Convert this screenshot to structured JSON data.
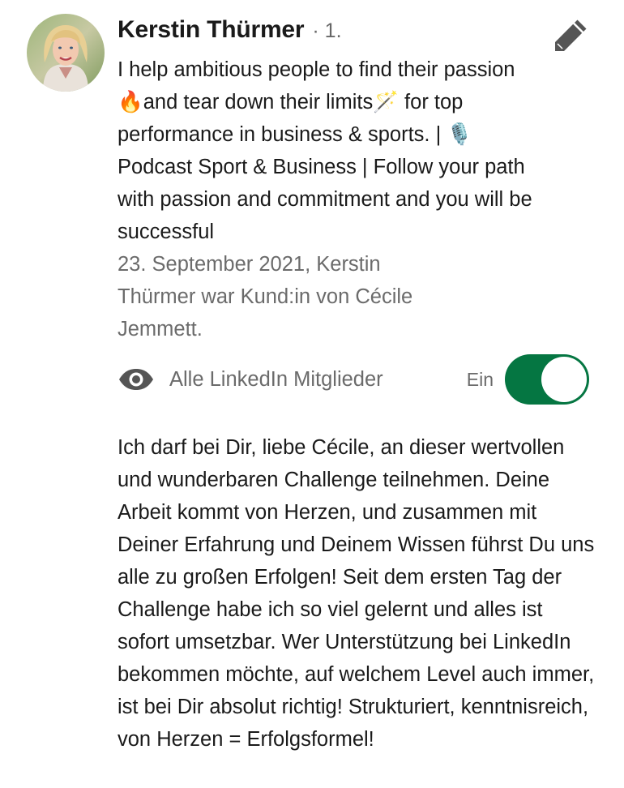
{
  "author": {
    "name": "Kerstin Thürmer",
    "degree": "· 1.",
    "headline": "I help ambitious people to find their passion🔥and tear down their limits🪄 for top performance in business & sports. | 🎙️Podcast Sport & Business | Follow your path with passion and commitment and you will be successful"
  },
  "recommendation": {
    "meta": "23. September 2021, Kerstin Thürmer war Kund:in von Cécile Jemmett.",
    "text": "Ich darf bei Dir, liebe Cécile, an dieser wertvollen und wunderbaren Challenge teilnehmen. Deine Arbeit kommt von Herzen, und zusammen mit Deiner Erfahrung und Deinem Wissen führst Du uns alle zu großen Erfolgen! Seit dem ersten Tag der Challenge habe ich so viel gelernt und alles ist sofort umsetzbar. Wer Unterstützung bei LinkedIn bekommen möchte, auf welchem Level auch immer, ist bei Dir absolut richtig! Strukturiert, kenntnisreich, von Herzen = Erfolgsformel!"
  },
  "visibility": {
    "label": "Alle LinkedIn Mitglieder",
    "toggle_label": "Ein",
    "toggle_on": true
  },
  "icons": {
    "edit": "pencil-icon",
    "visibility": "eye-icon"
  },
  "colors": {
    "toggle_on": "#057642",
    "secondary_text": "#6b6b6b",
    "primary_text": "#1a1a1a"
  }
}
